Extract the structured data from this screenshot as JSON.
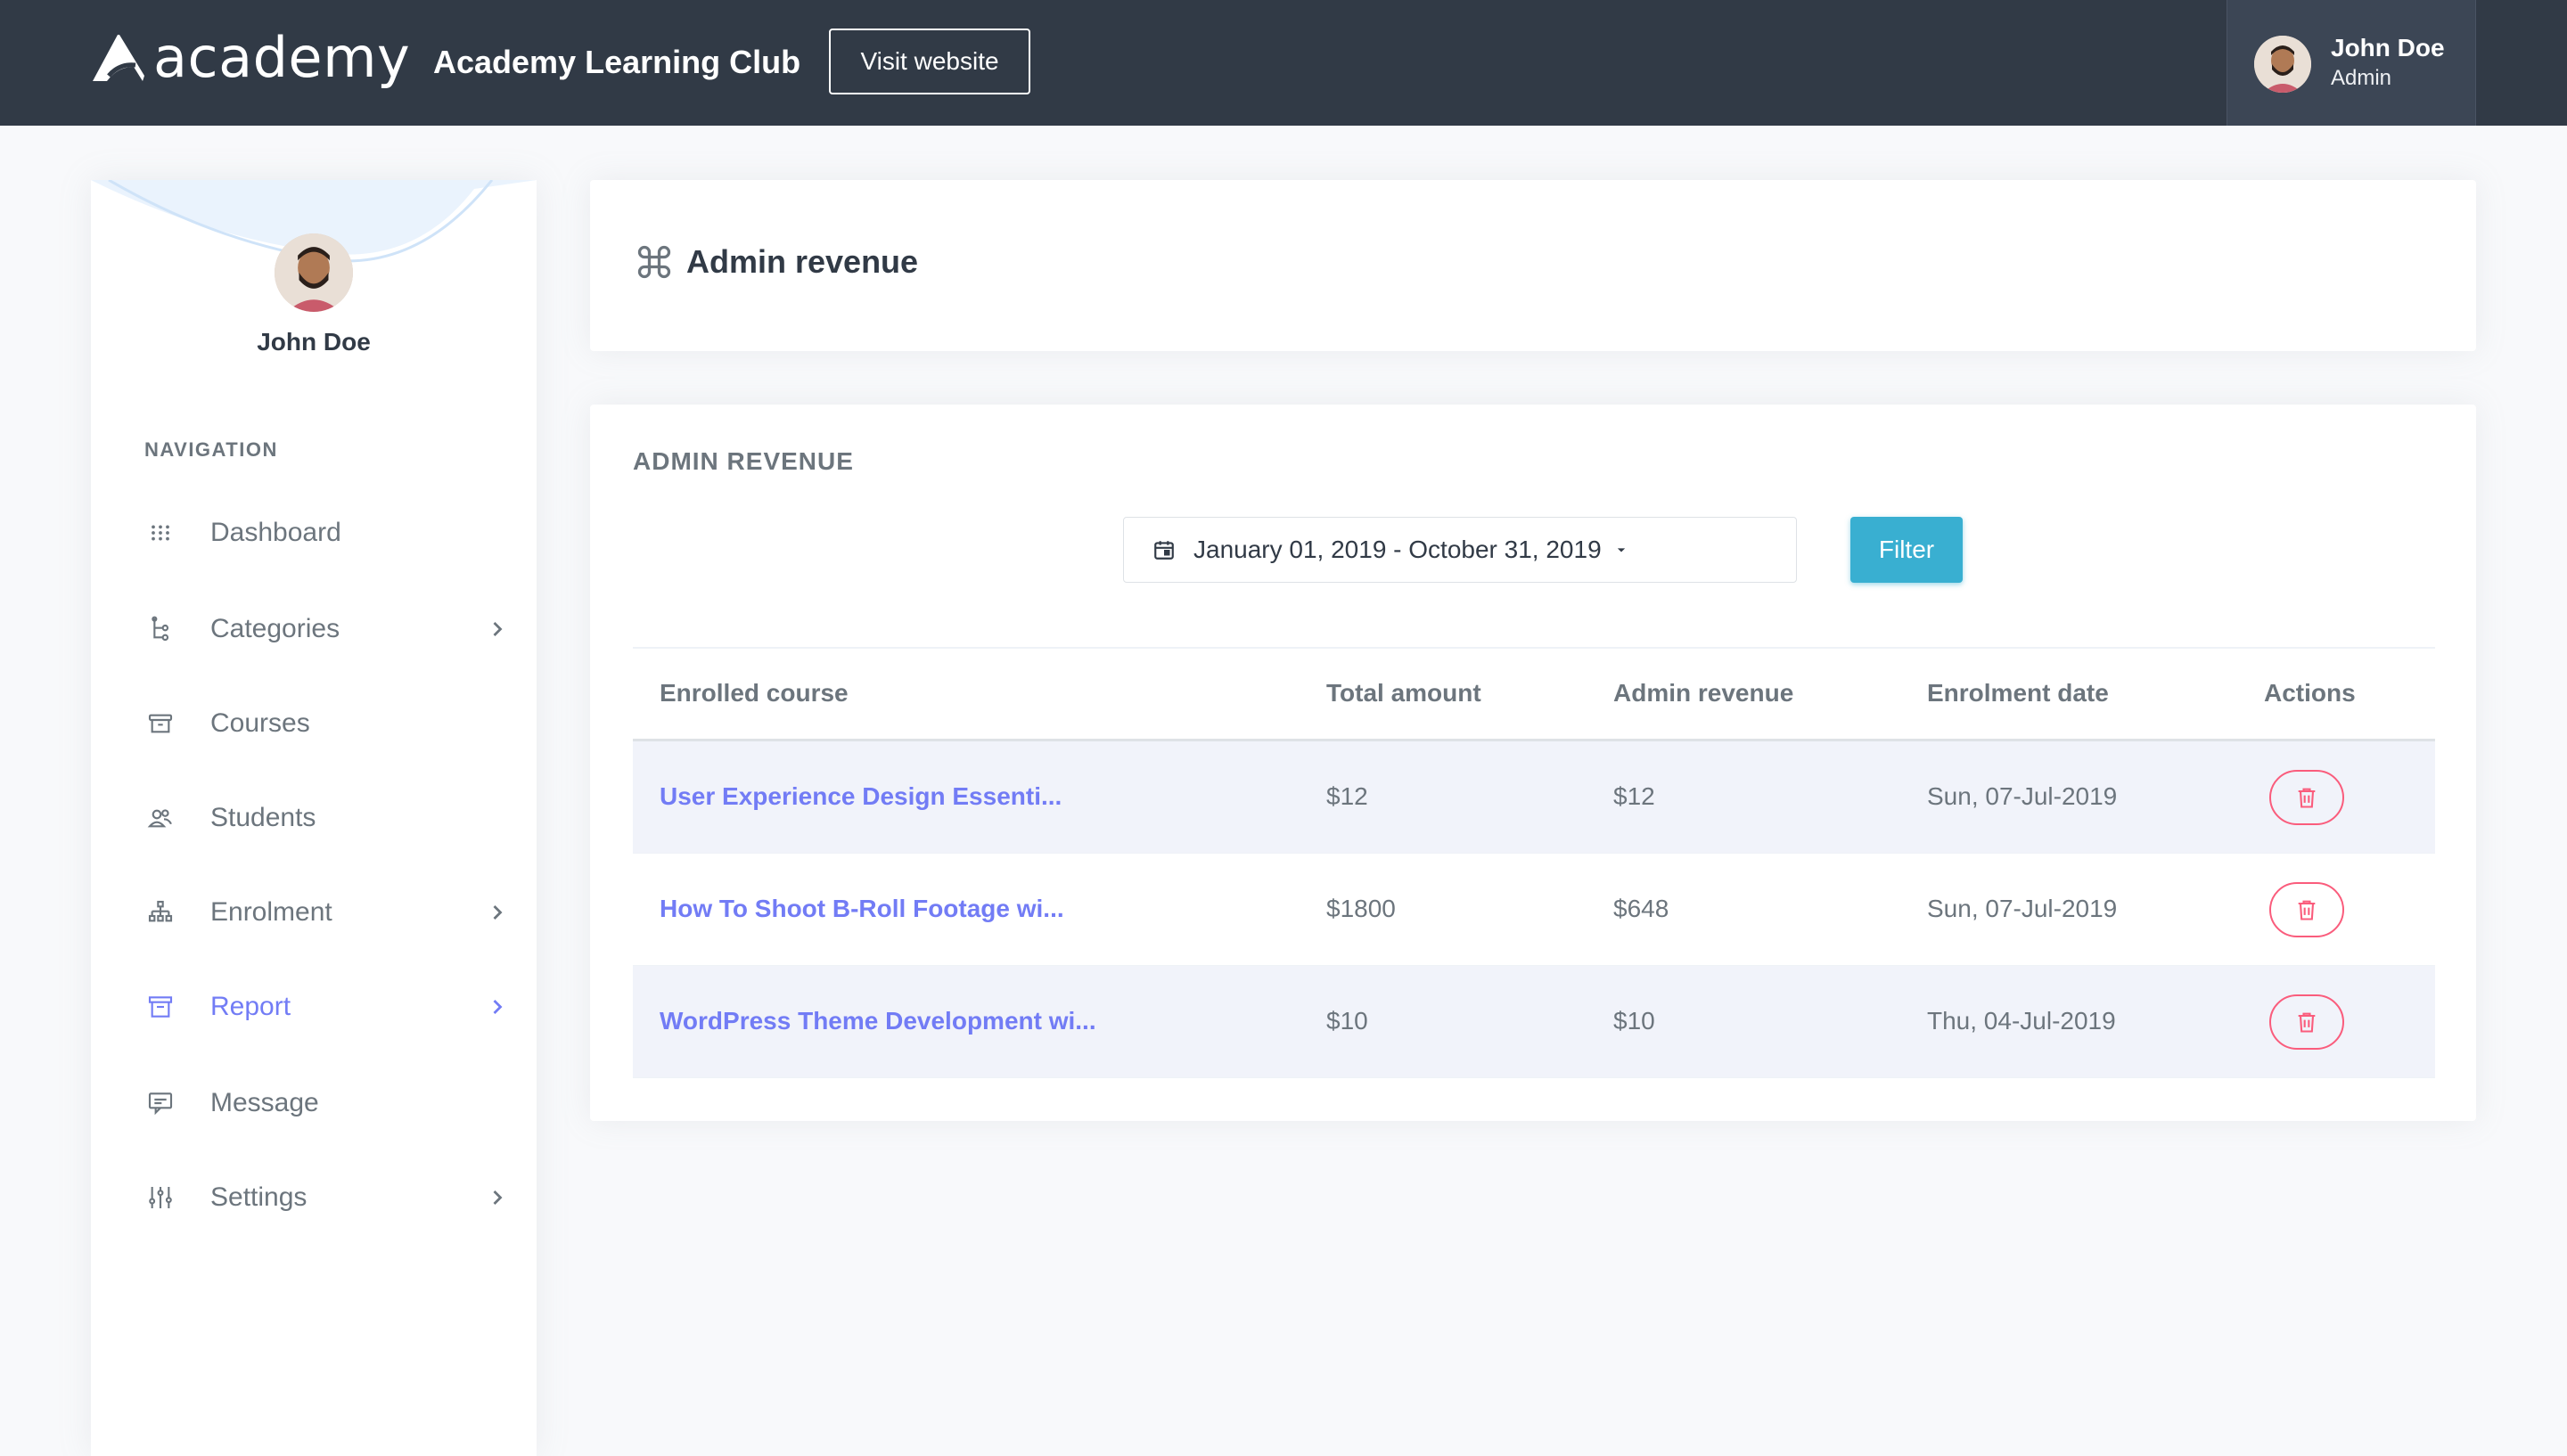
{
  "header": {
    "logo_text": "academy",
    "site_name": "Academy Learning Club",
    "visit_button": "Visit website",
    "user": {
      "name": "John Doe",
      "role": "Admin"
    }
  },
  "sidebar": {
    "user_name": "John Doe",
    "nav_title": "NAVIGATION",
    "items": [
      {
        "label": "Dashboard",
        "icon": "grid-icon",
        "has_submenu": false
      },
      {
        "label": "Categories",
        "icon": "tree-icon",
        "has_submenu": true
      },
      {
        "label": "Courses",
        "icon": "archive-icon",
        "has_submenu": false
      },
      {
        "label": "Students",
        "icon": "users-icon",
        "has_submenu": false
      },
      {
        "label": "Enrolment",
        "icon": "network-icon",
        "has_submenu": true
      },
      {
        "label": "Report",
        "icon": "box-icon",
        "has_submenu": true,
        "active": true
      },
      {
        "label": "Message",
        "icon": "message-icon",
        "has_submenu": false
      },
      {
        "label": "Settings",
        "icon": "sliders-icon",
        "has_submenu": true
      }
    ]
  },
  "page": {
    "title": "Admin revenue",
    "title_icon": "command-icon"
  },
  "revenue": {
    "heading": "ADMIN REVENUE",
    "date_range": "January 01, 2019 - October 31, 2019",
    "filter_button": "Filter",
    "columns": [
      "Enrolled course",
      "Total amount",
      "Admin revenue",
      "Enrolment date",
      "Actions"
    ],
    "rows": [
      {
        "course": "User Experience Design Essenti...",
        "total": "$12",
        "admin_revenue": "$12",
        "date": "Sun, 07-Jul-2019"
      },
      {
        "course": "How To Shoot B-Roll Footage wi...",
        "total": "$1800",
        "admin_revenue": "$648",
        "date": "Sun, 07-Jul-2019"
      },
      {
        "course": "WordPress Theme Development wi...",
        "total": "$10",
        "admin_revenue": "$10",
        "date": "Thu, 04-Jul-2019"
      }
    ]
  },
  "colors": {
    "topbar": "#313a46",
    "primary": "#727cf5",
    "info": "#39afd1",
    "danger": "#fa5c7c"
  }
}
